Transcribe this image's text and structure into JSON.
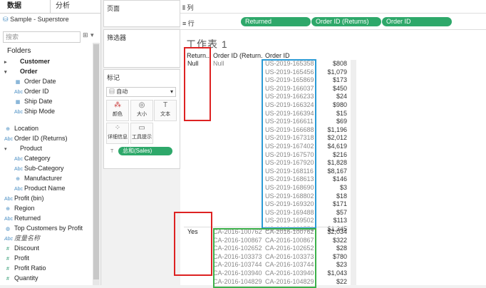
{
  "left_pane": {
    "tab_data": "数据",
    "tab_analysis": "分析",
    "datasource": "Sample - Superstore",
    "search_placeholder": "搜索",
    "folders_label": "Folders",
    "fields": [
      {
        "label": "Customer",
        "kind": "folder",
        "bold": true
      },
      {
        "label": "Order",
        "kind": "folder-open",
        "bold": true
      },
      {
        "label": "Order Date",
        "kind": "date",
        "indent": true
      },
      {
        "label": "Order ID",
        "kind": "dim",
        "indent": true
      },
      {
        "label": "Ship Date",
        "kind": "date",
        "indent": true
      },
      {
        "label": "Ship Mode",
        "kind": "dim",
        "indent": true
      },
      {
        "label": "",
        "kind": "gap"
      },
      {
        "label": "Location",
        "kind": "geo"
      },
      {
        "label": "Order ID (Returns)",
        "kind": "dim"
      },
      {
        "label": "Product",
        "kind": "hier"
      },
      {
        "label": "Category",
        "kind": "dim",
        "indent": true
      },
      {
        "label": "Sub-Category",
        "kind": "dim",
        "indent": true
      },
      {
        "label": "Manufacturer",
        "kind": "geo",
        "indent": true
      },
      {
        "label": "Product Name",
        "kind": "dim",
        "indent": true
      },
      {
        "label": "Profit (bin)",
        "kind": "dim"
      },
      {
        "label": "Region",
        "kind": "geo"
      },
      {
        "label": "Returned",
        "kind": "dim"
      },
      {
        "label": "Top Customers by Profit",
        "kind": "set"
      },
      {
        "label": "度量名称",
        "kind": "italic"
      },
      {
        "label": "Discount",
        "kind": "measure"
      },
      {
        "label": "Profit",
        "kind": "measure"
      },
      {
        "label": "Profit Ratio",
        "kind": "measure"
      },
      {
        "label": "Quantity",
        "kind": "measure"
      }
    ]
  },
  "shelves": {
    "pages_label": "页面",
    "filters_label": "筛选器",
    "marks_label": "标记",
    "columns_label": "列",
    "rows_label": "行",
    "mark_type": "自动",
    "mark_buttons": [
      {
        "label": "颜色",
        "icon": "color-icon"
      },
      {
        "label": "大小",
        "icon": "size-icon"
      },
      {
        "label": "文本",
        "icon": "text-icon"
      },
      {
        "label": "详细信息",
        "icon": "detail-icon"
      },
      {
        "label": "工具提示",
        "icon": "tooltip-icon"
      }
    ],
    "marks_pill": "总和(Sales)",
    "row_pills": [
      "Returned",
      "Order ID (Returns)",
      "Order ID"
    ]
  },
  "sheet": {
    "title": "工作表 1",
    "headers": [
      "Return..",
      "Order ID (Return..",
      "Order ID"
    ],
    "group1": {
      "returned": "Null",
      "returns_id": "Null",
      "rows": [
        [
          "US-2019-165358",
          "$808"
        ],
        [
          "US-2019-165456",
          "$1,079"
        ],
        [
          "US-2019-165869",
          "$173"
        ],
        [
          "US-2019-166037",
          "$450"
        ],
        [
          "US-2019-166233",
          "$24"
        ],
        [
          "US-2019-166324",
          "$980"
        ],
        [
          "US-2019-166394",
          "$15"
        ],
        [
          "US-2019-166611",
          "$69"
        ],
        [
          "US-2019-166688",
          "$1,196"
        ],
        [
          "US-2019-167318",
          "$2,012"
        ],
        [
          "US-2019-167402",
          "$4,619"
        ],
        [
          "US-2019-167570",
          "$216"
        ],
        [
          "US-2019-167920",
          "$1,828"
        ],
        [
          "US-2019-168116",
          "$8,167"
        ],
        [
          "US-2019-168613",
          "$146"
        ],
        [
          "US-2019-168690",
          "$3"
        ],
        [
          "US-2019-168802",
          "$18"
        ],
        [
          "US-2019-169320",
          "$171"
        ],
        [
          "US-2019-169488",
          "$57"
        ],
        [
          "US-2019-169502",
          "$113"
        ],
        [
          "US-2019-169551",
          "$1,345"
        ]
      ]
    },
    "group2": {
      "returned": "Yes",
      "rows": [
        [
          "CA-2016-100762",
          "CA-2016-100762",
          "$2,034"
        ],
        [
          "CA-2016-100867",
          "CA-2016-100867",
          "$322"
        ],
        [
          "CA-2016-102652",
          "CA-2016-102652",
          "$28"
        ],
        [
          "CA-2016-103373",
          "CA-2016-103373",
          "$780"
        ],
        [
          "CA-2016-103744",
          "CA-2016-103744",
          "$23"
        ],
        [
          "CA-2016-103940",
          "CA-2016-103940",
          "$1,043"
        ],
        [
          "CA-2016-104829",
          "CA-2016-104829",
          "$22"
        ]
      ]
    }
  },
  "colors": {
    "pill": "#2ea86a",
    "red_box": "#dd2222",
    "blue_box": "#2a9ad5",
    "green_box": "#3cb04a"
  }
}
